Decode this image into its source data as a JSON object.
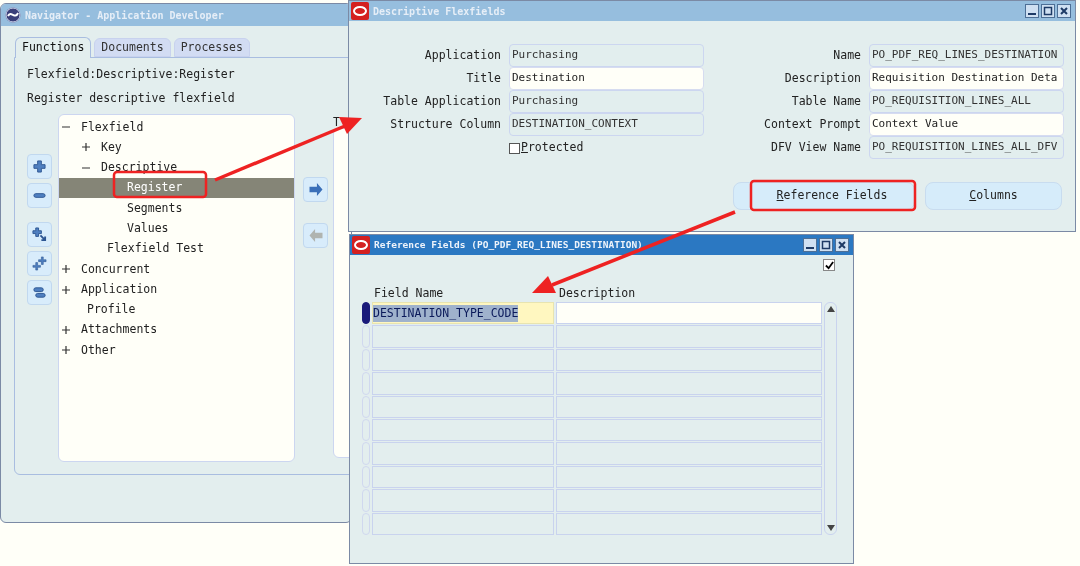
{
  "navigator": {
    "title": "Navigator - Application Developer",
    "tabs": [
      {
        "label": "Functions",
        "selected": true
      },
      {
        "label": "Documents",
        "selected": false
      },
      {
        "label": "Processes",
        "selected": false
      }
    ],
    "path": "Flexfield:Descriptive:Register",
    "description": "Register descriptive flexfield",
    "tree": [
      {
        "label": "Flexfield",
        "expanded": true,
        "selected": false,
        "children": [
          {
            "label": "Key",
            "expanded": false,
            "selected": false
          },
          {
            "label": "Descriptive",
            "expanded": true,
            "selected": false,
            "children": [
              {
                "label": "Register",
                "selected": true
              },
              {
                "label": "Segments",
                "selected": false
              },
              {
                "label": "Values",
                "selected": false
              }
            ]
          },
          {
            "label": "Flexfield Test",
            "selected": false
          }
        ]
      },
      {
        "label": "Concurrent",
        "expanded": false,
        "selected": false
      },
      {
        "label": "Application",
        "expanded": false,
        "selected": false
      },
      {
        "label": "Profile",
        "selected": false
      },
      {
        "label": "Attachments",
        "expanded": false,
        "selected": false
      },
      {
        "label": "Other",
        "expanded": false,
        "selected": false
      }
    ],
    "side_label": "T",
    "left_arrow_disabled": true
  },
  "descriptive_flexfields": {
    "title": "Descriptive Flexfields",
    "left_fields": [
      {
        "label": "Application",
        "value": "Purchasing",
        "editable": false
      },
      {
        "label": "Title",
        "value": "Destination",
        "editable": true
      },
      {
        "label": "Table Application",
        "value": "Purchasing",
        "editable": false
      },
      {
        "label": "Structure Column",
        "value": "DESTINATION_CONTEXT",
        "editable": false
      }
    ],
    "protected": {
      "label": "Protected",
      "checked": false,
      "underline_first": true
    },
    "right_fields": [
      {
        "label": "Name",
        "value": "PO_PDF_REQ_LINES_DESTINATION",
        "editable": false
      },
      {
        "label": "Description",
        "value": "Requisition Destination Deta",
        "editable": true
      },
      {
        "label": "Table Name",
        "value": "PO_REQUISITION_LINES_ALL",
        "editable": false
      },
      {
        "label": "Context Prompt",
        "value": "Context Value",
        "editable": true
      },
      {
        "label": "DFV View Name",
        "value": "PO_REQUISITION_LINES_ALL_DFV",
        "editable": false
      }
    ],
    "buttons": [
      {
        "label": "Reference Fields",
        "underline_first": true
      },
      {
        "label": "Columns",
        "underline_first": true
      }
    ]
  },
  "reference_fields": {
    "title": "Reference Fields (PO_PDF_REQ_LINES_DESTINATION)",
    "checked": true,
    "columns": [
      "Field Name",
      "Description"
    ],
    "rows": [
      {
        "field_name": "DESTINATION_TYPE_CODE",
        "current": true,
        "text_selected": true
      },
      {
        "current": false
      },
      {
        "current": false
      },
      {
        "current": false
      },
      {
        "current": false
      },
      {
        "current": false
      },
      {
        "current": false
      },
      {
        "current": false
      },
      {
        "current": false
      },
      {
        "current": false
      }
    ]
  }
}
